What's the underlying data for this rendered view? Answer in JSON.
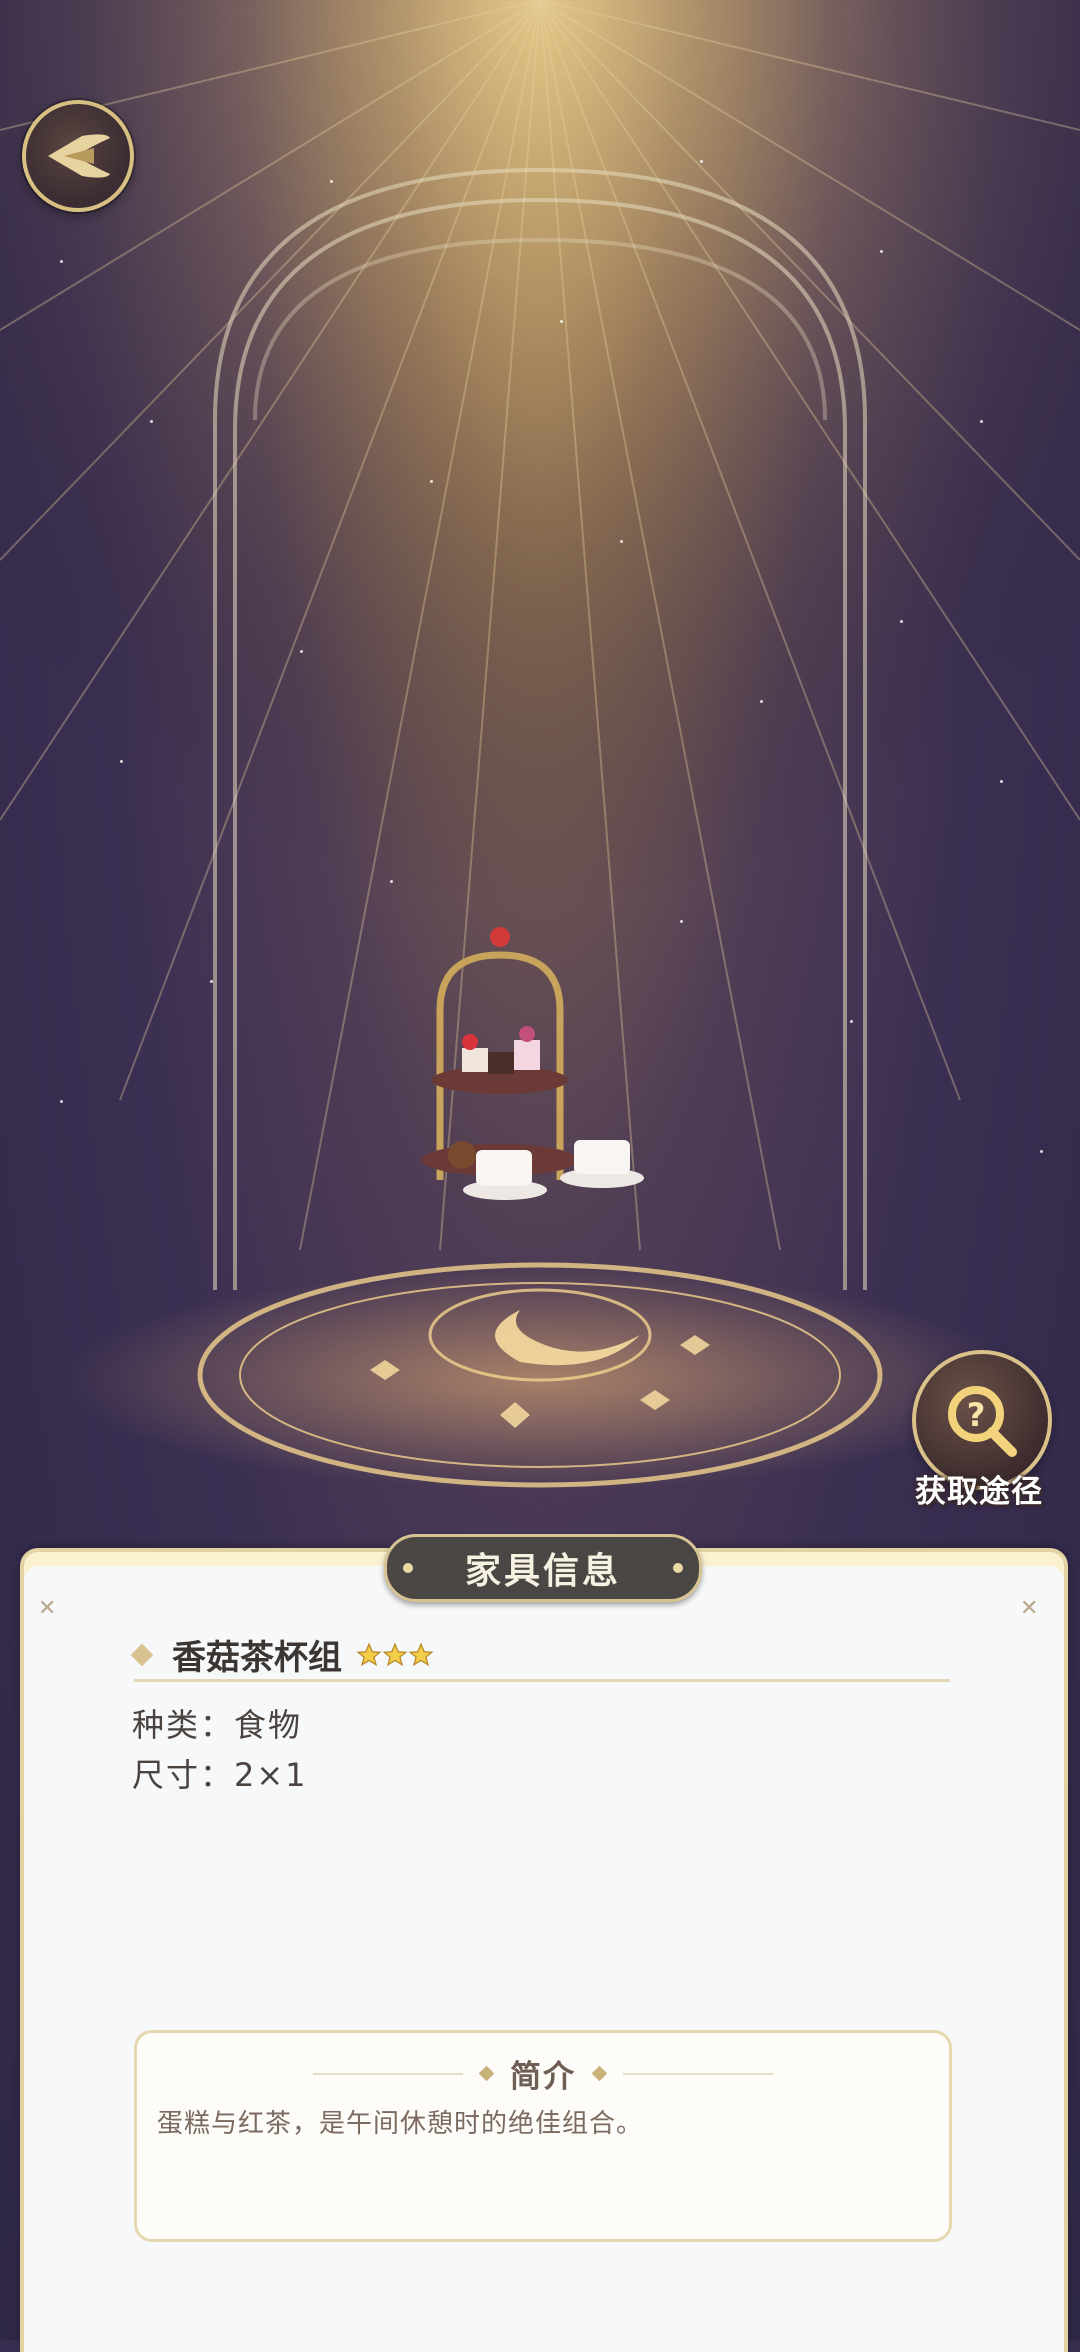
{
  "panel": {
    "title": "家具信息",
    "item": {
      "name": "香菇茶杯组",
      "rating": 3
    },
    "category": "种类：食物",
    "size": "尺寸：2×1",
    "intro": {
      "title": "简介",
      "text": "蛋糕与红茶，是午间休憩时的绝佳组合。"
    }
  },
  "actions": {
    "source_label": "获取途径"
  },
  "colors": {
    "gold": "#d8c390",
    "panel_bg": "#f7f8fa",
    "tab_bg": "#4a4643",
    "sky_top": "#b79a5e",
    "sky_bottom": "#2f2748"
  }
}
